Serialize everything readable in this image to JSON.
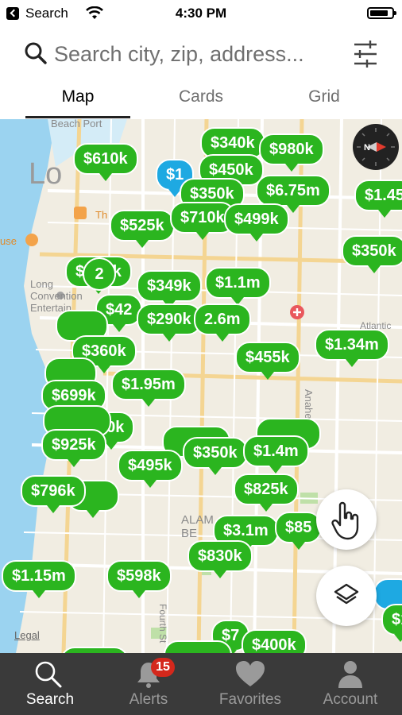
{
  "status_bar": {
    "back_app": "Search",
    "time": "4:30 PM"
  },
  "search": {
    "placeholder": "Search city, zip, address..."
  },
  "tabs": [
    {
      "label": "Map"
    },
    {
      "label": "Cards"
    },
    {
      "label": "Grid"
    }
  ],
  "active_tab": "Map",
  "map": {
    "labels": {
      "city": "Lo",
      "port": "Beach Port",
      "center": "Long\nConvention\nEntertain",
      "house": "use",
      "theatre": "Th",
      "street_a": "Anaheim St",
      "street_b": "Fourth St",
      "alamitos": "ALAM\nBE",
      "atlantic": "Atlantic"
    },
    "pins": [
      {
        "label": "$610k"
      },
      {
        "label": "$340k"
      },
      {
        "label": "$980k"
      },
      {
        "label": "$450k"
      },
      {
        "label": "$350k"
      },
      {
        "label": "$6.75m"
      },
      {
        "label": "$1.45"
      },
      {
        "label": "$525k"
      },
      {
        "label": "$710k"
      },
      {
        "label": "$499k"
      },
      {
        "label": "$350k"
      },
      {
        "label": "$349k"
      },
      {
        "label": "$1.1m"
      },
      {
        "label": "$42"
      },
      {
        "label": "$290k"
      },
      {
        "label": "2.6m"
      },
      {
        "label": "$1.34m"
      },
      {
        "label": "$360k"
      },
      {
        "label": "$455k"
      },
      {
        "label": "$1.95m"
      },
      {
        "label": "$699k"
      },
      {
        "label": "10k"
      },
      {
        "label": "$925k"
      },
      {
        "label": "$495k"
      },
      {
        "label": "$350k"
      },
      {
        "label": "$1.4m"
      },
      {
        "label": "$796k"
      },
      {
        "label": "$825k"
      },
      {
        "label": "$3.1m"
      },
      {
        "label": "$85"
      },
      {
        "label": "$830k"
      },
      {
        "label": "$1.15m"
      },
      {
        "label": "$598k"
      },
      {
        "label": "$7"
      },
      {
        "label": "$400k"
      },
      {
        "label": "$1"
      }
    ],
    "cluster_count": "2",
    "legal": "Legal"
  },
  "tab_bar": [
    {
      "label": "Search",
      "icon": "search-icon"
    },
    {
      "label": "Alerts",
      "icon": "bell-icon",
      "badge": "15"
    },
    {
      "label": "Favorites",
      "icon": "heart-icon"
    },
    {
      "label": "Account",
      "icon": "person-icon"
    }
  ],
  "colors": {
    "pin_green": "#2bb51f",
    "pin_blue": "#1ea9e2",
    "tab_bar_bg": "#3a3a3a",
    "badge_red": "#d4281c"
  }
}
